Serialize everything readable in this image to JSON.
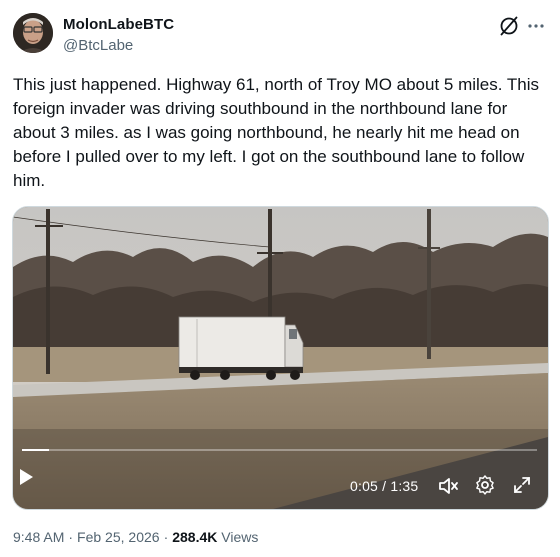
{
  "author": {
    "display_name": "MolonLabeBTC",
    "handle": "@BtcLabe",
    "avatar_icon": "avatar-photo"
  },
  "header_actions": {
    "grok_icon": "grok-icon",
    "more_icon": "more-icon"
  },
  "tweet": {
    "text": "This just happened. Highway 61, north of Troy MO about 5 miles. This foreign invader was driving southbound in the northbound lane for about 3 miles. as I was going northbound, he nearly hit me head on before I pulled over to my left. I got on the southbound lane to follow him."
  },
  "video": {
    "current_time": "0:05",
    "duration": "1:35",
    "time_separator": "/",
    "progress_fraction": 0.053,
    "controls": {
      "play_icon": "play-icon",
      "mute_icon": "volume-muted-icon",
      "settings_icon": "settings-gear-icon",
      "fullscreen_icon": "fullscreen-icon"
    }
  },
  "meta": {
    "time": "9:48 AM",
    "separator": "·",
    "date": "Feb 25, 2026",
    "views_count": "288.4K",
    "views_label": "Views"
  },
  "colors": {
    "text_primary": "#0f1419",
    "text_secondary": "#536471",
    "border": "#cfd9de"
  }
}
